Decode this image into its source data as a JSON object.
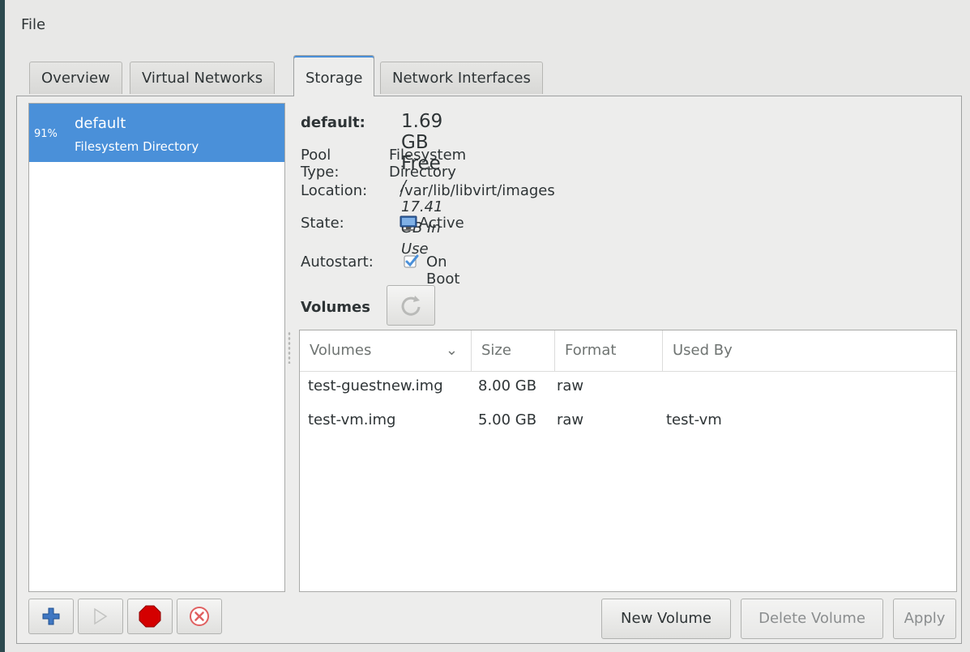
{
  "menu": {
    "file_label": "File"
  },
  "tabs": [
    {
      "label": "Overview"
    },
    {
      "label": "Virtual Networks"
    },
    {
      "label": "Storage",
      "active": true
    },
    {
      "label": "Network Interfaces"
    }
  ],
  "pools": [
    {
      "percent": "91%",
      "name": "default",
      "type": "Filesystem Directory",
      "selected": true
    }
  ],
  "pool_toolbar": {
    "add_icon": "plus-icon",
    "start_icon": "play-icon",
    "stop_icon": "stop-icon",
    "delete_icon": "delete-icon"
  },
  "details": {
    "name_label": "default:",
    "free": "1.69 GB Free",
    "in_use": "/ 17.41 GB In Use",
    "pool_type_label": "Pool Type:",
    "pool_type_value": "Filesystem Directory",
    "location_label": "Location:",
    "location_value": "/var/lib/libvirt/images",
    "state_label": "State:",
    "state_value": "Active",
    "autostart_label": "Autostart:",
    "autostart_value": "On Boot",
    "autostart_checked": true,
    "volumes_label": "Volumes"
  },
  "volumes": {
    "columns": [
      "Volumes",
      "Size",
      "Format",
      "Used By"
    ],
    "rows": [
      {
        "name": "test-guestnew.img",
        "size": "8.00 GB",
        "format": "raw",
        "used_by": ""
      },
      {
        "name": "test-vm.img",
        "size": "5.00 GB",
        "format": "raw",
        "used_by": "test-vm"
      }
    ]
  },
  "buttons": {
    "new_volume": "New Volume",
    "delete_volume": "Delete Volume",
    "apply": "Apply"
  },
  "colors": {
    "selection": "#4a90d9",
    "stop": "#d40000",
    "add": "#3465a4"
  }
}
